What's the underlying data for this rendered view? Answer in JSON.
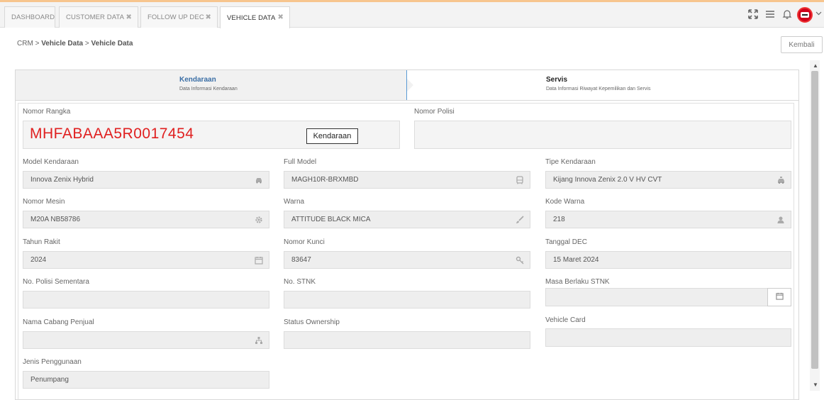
{
  "tabs": [
    {
      "label": "DASHBOARD"
    },
    {
      "label": "CUSTOMER DATA",
      "close": "✖"
    },
    {
      "label": "FOLLOW UP DEC",
      "close": "✖"
    },
    {
      "label": "VEHICLE DATA",
      "close": "✖"
    }
  ],
  "header_icons": [
    "expand-icon",
    "menu-icon",
    "bell-icon",
    "avatar",
    "chevron-down-icon"
  ],
  "breadcrumb": {
    "root": "CRM",
    "sep1": ">",
    "mid": "Vehicle Data",
    "sep2": ">",
    "current": "Vehicle Data"
  },
  "back_button": "Kembali",
  "steps": [
    {
      "title": "Kendaraan",
      "subtitle": "Data Informasi Kendaraan",
      "active": true
    },
    {
      "title": "Servis",
      "subtitle": "Data Informasi Riwayat Kepemilikan dan Servis",
      "active": false
    }
  ],
  "form": {
    "nomor_rangka": {
      "label": "Nomor Rangka",
      "value": "MHFABAAA5R0017454",
      "button": "Kendaraan"
    },
    "nomor_polisi": {
      "label": "Nomor Polisi",
      "value": ""
    },
    "model_kendaraan": {
      "label": "Model Kendaraan",
      "value": "Innova Zenix Hybrid",
      "icon": "car-icon"
    },
    "full_model": {
      "label": "Full Model",
      "value": "MAGH10R-BRXMBD",
      "icon": "bus-icon"
    },
    "tipe_kendaraan": {
      "label": "Tipe Kendaraan",
      "value": "Kijang Innova Zenix 2.0 V HV CVT",
      "icon": "taxi-icon"
    },
    "nomor_mesin": {
      "label": "Nomor Mesin",
      "value": "M20A NB58786",
      "icon": "gear-icon"
    },
    "warna": {
      "label": "Warna",
      "value": "ATTITUDE BLACK MICA",
      "icon": "paintbrush-icon"
    },
    "kode_warna": {
      "label": "Kode Warna",
      "value": "218",
      "icon": "user-icon"
    },
    "tahun_rakit": {
      "label": "Tahun Rakit",
      "value": "2024",
      "icon": "calendar-icon"
    },
    "nomor_kunci": {
      "label": "Nomor Kunci",
      "value": "83647",
      "icon": "key-icon"
    },
    "tanggal_dec": {
      "label": "Tanggal DEC",
      "value": "15 Maret 2024"
    },
    "no_polisi_sementara": {
      "label": "No. Polisi Sementara",
      "value": ""
    },
    "no_stnk": {
      "label": "No. STNK",
      "value": ""
    },
    "masa_berlaku_stnk": {
      "label": "Masa Berlaku STNK",
      "value": "",
      "icon": "calendar-icon"
    },
    "nama_cabang_penjual": {
      "label": "Nama Cabang Penjual",
      "value": "",
      "icon": "sitemap-icon"
    },
    "status_ownership": {
      "label": "Status Ownership",
      "value": ""
    },
    "vehicle_card": {
      "label": "Vehicle Card",
      "value": ""
    },
    "jenis_penggunaan": {
      "label": "Jenis Penggunaan",
      "value": "Penumpang"
    }
  },
  "colors": {
    "vin": "#e02020",
    "active_step": "#3a6ea5",
    "accent_line": "#f7c58e",
    "avatar": "#d0021b"
  }
}
